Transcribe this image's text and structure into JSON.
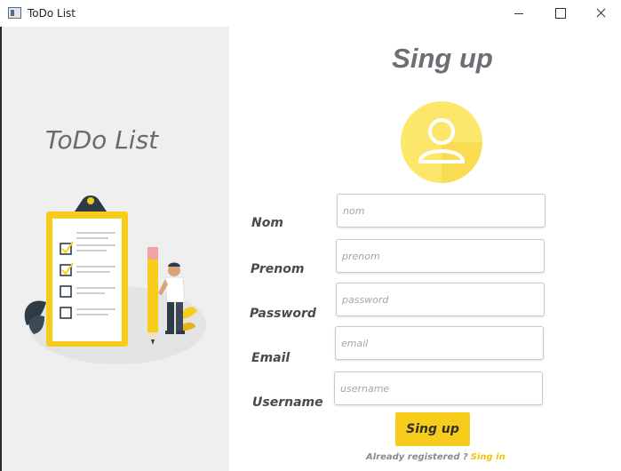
{
  "window": {
    "title": "ToDo List"
  },
  "sidebar": {
    "title": "ToDo List"
  },
  "form": {
    "heading": "Sing up",
    "fields": [
      {
        "label": "Nom",
        "placeholder": "nom"
      },
      {
        "label": "Prenom",
        "placeholder": "prenom"
      },
      {
        "label": "Password",
        "placeholder": "password"
      },
      {
        "label": "Email",
        "placeholder": "email"
      },
      {
        "label": "Username",
        "placeholder": "username"
      }
    ],
    "submit_label": "Sing up",
    "footer_text": "Already registered ?",
    "footer_link": "Sing in"
  },
  "colors": {
    "accent": "#f8cc1b",
    "panel_bg": "#efefef",
    "heading": "#6e6d74"
  },
  "icons": [
    "app-window-icon",
    "minimize-icon",
    "maximize-icon",
    "close-icon",
    "user-avatar-icon",
    "todo-checklist-illustration"
  ]
}
